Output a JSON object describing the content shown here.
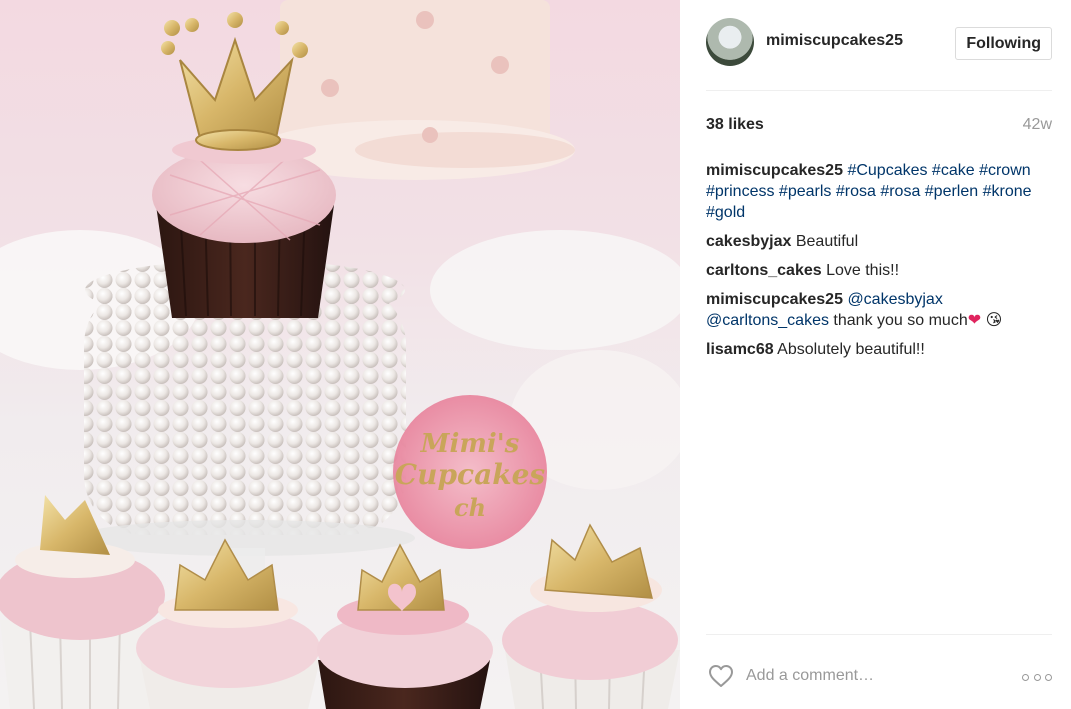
{
  "post": {
    "image": {
      "alt": "Pearl cake with crowned cupcake",
      "watermark_line1": "Mimi's",
      "watermark_line2": "Cupcakes",
      "watermark_line3": "ch"
    },
    "header": {
      "username": "mimiscupcakes25",
      "follow_label": "Following"
    },
    "likes_label": "38 likes",
    "age": "42w",
    "comments": [
      {
        "user": "mimiscupcakes25",
        "text": "#Cupcakes #cake #crown #princess #pearls #rosa #rosa #perlen #krone #gold"
      },
      {
        "user": "cakesbyjax",
        "text": "Beautiful"
      },
      {
        "user": "carltons_cakes",
        "text": "Love this!!"
      },
      {
        "user": "mimiscupcakes25",
        "mention1": "@cakesbyjax",
        "mention2": "@carltons_cakes",
        "text": "thank you so much",
        "emoji1": "❤",
        "emoji2": "😘"
      },
      {
        "user": "lisamc68",
        "text": "Absolutely beautiful!!"
      }
    ],
    "footer": {
      "comment_placeholder": "Add a comment…"
    }
  },
  "colors": {
    "text": "#262626",
    "hashtag": "#003569",
    "muted": "#999999",
    "divider": "#efefef"
  }
}
